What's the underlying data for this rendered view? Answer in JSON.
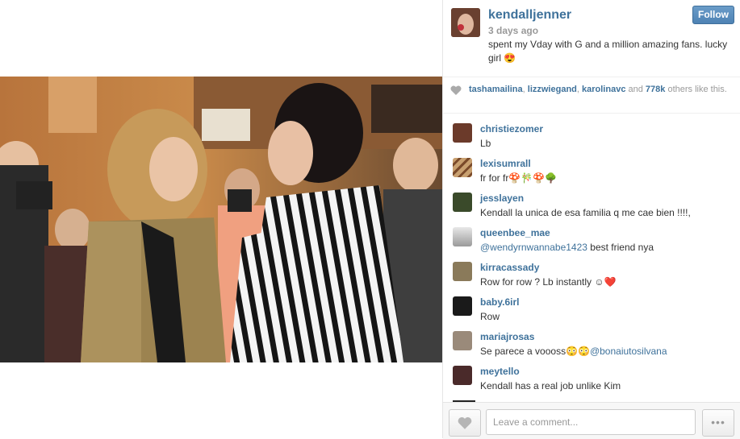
{
  "post": {
    "username": "kendalljenner",
    "age": "3 days ago",
    "caption": "spent my Vday with G and a million amazing fans. lucky girl 😍",
    "follow_label": "Follow"
  },
  "likes": {
    "names": [
      "tashamailina",
      "lizzwiegand",
      "karolinavc"
    ],
    "separator": ", ",
    "and_text": " and ",
    "others_count": "778k",
    "others_suffix": " others like this."
  },
  "comments": [
    {
      "user": "christiezomer",
      "text": "Lb",
      "avatar_color": "#6b3a2a"
    },
    {
      "user": "lexisumrall",
      "text": "fr for fr🍄🎋🍄🌳",
      "avatar_color": "#c8a070"
    },
    {
      "user": "jesslayen",
      "text": "Kendall la unica de esa familia q me cae bien !!!!,",
      "avatar_color": "#3a4a2a"
    },
    {
      "user": "queenbee_mae",
      "mention": "@wendyrnwannabe1423",
      "text": " best friend nya",
      "avatar_color": "#d8d8d8"
    },
    {
      "user": "kirracassady",
      "text": "Row for row ? Lb instantly ☺❤️",
      "avatar_color": "#8a7a5a"
    },
    {
      "user": "baby.6irl",
      "text": "Row",
      "avatar_color": "#1a1a1a"
    },
    {
      "user": "mariajrosas",
      "text": "Se parece a voooss😳😳",
      "mention_after": "@bonaiutosilvana",
      "avatar_color": "#9a8a7a"
    },
    {
      "user": "meytello",
      "text": "Kendall has a real job unlike Kim",
      "avatar_color": "#4a2a2a"
    }
  ],
  "footer": {
    "comment_placeholder": "Leave a comment...",
    "more_label": "•••"
  },
  "icons": {
    "heart": "heart-icon",
    "more": "ellipsis-icon"
  },
  "colors": {
    "link": "#3f729b",
    "muted": "#999999",
    "follow_button": "#4e82b4"
  }
}
